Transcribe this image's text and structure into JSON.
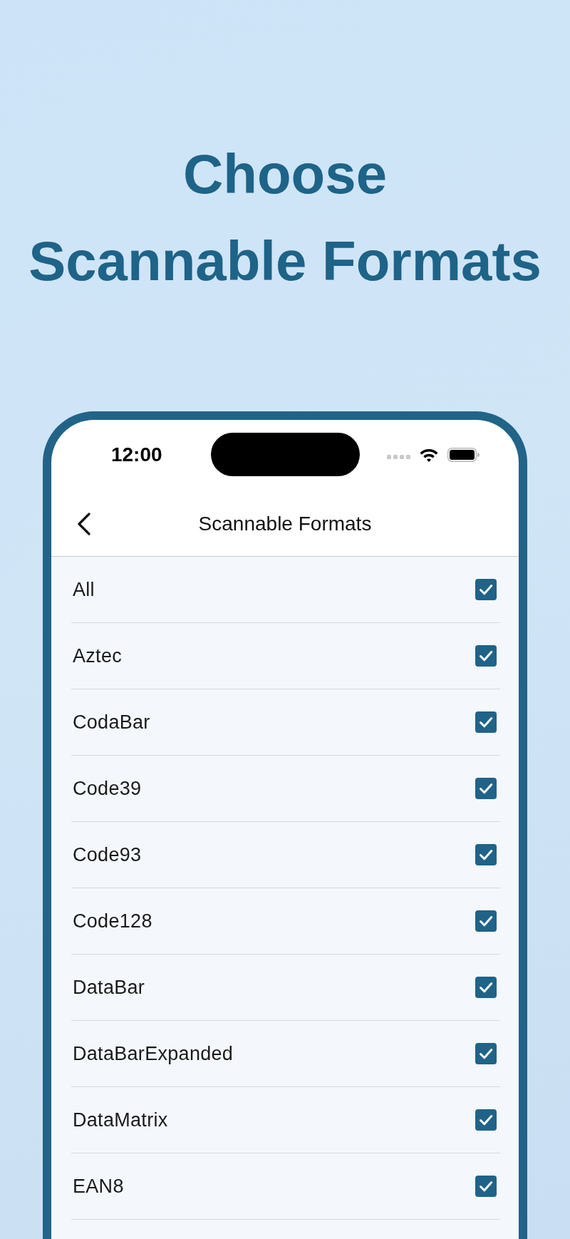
{
  "headline": "Choose\nScannable Formats",
  "status_bar": {
    "time": "12:00"
  },
  "nav_bar": {
    "title": "Scannable Formats"
  },
  "formats": [
    {
      "label": "All",
      "checked": true
    },
    {
      "label": "Aztec",
      "checked": true
    },
    {
      "label": "CodaBar",
      "checked": true
    },
    {
      "label": "Code39",
      "checked": true
    },
    {
      "label": "Code93",
      "checked": true
    },
    {
      "label": "Code128",
      "checked": true
    },
    {
      "label": "DataBar",
      "checked": true
    },
    {
      "label": "DataBarExpanded",
      "checked": true
    },
    {
      "label": "DataMatrix",
      "checked": true
    },
    {
      "label": "EAN8",
      "checked": true
    }
  ]
}
